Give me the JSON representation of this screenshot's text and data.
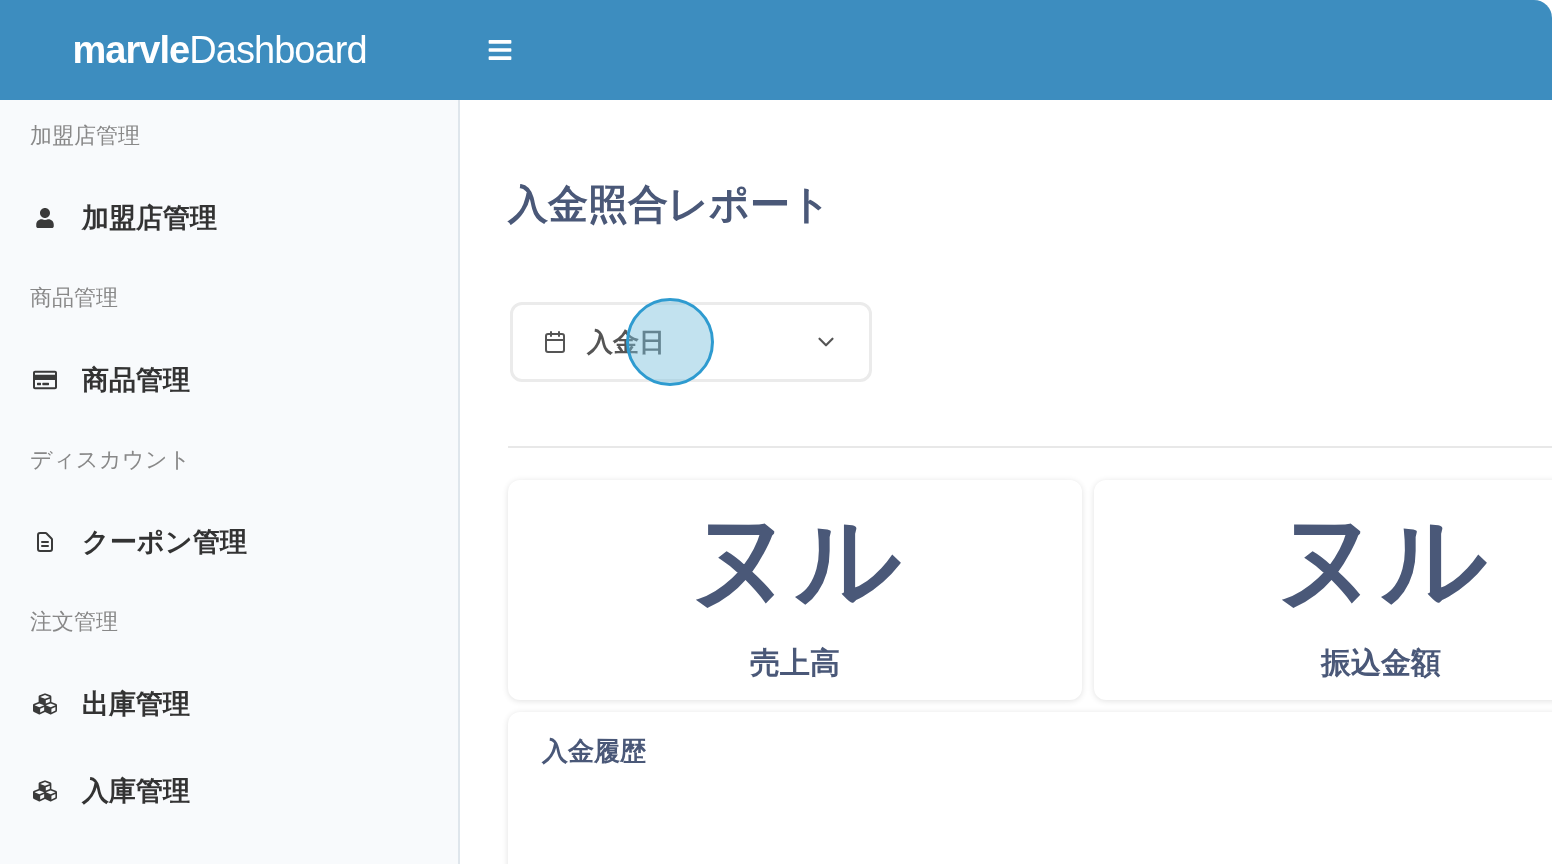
{
  "header": {
    "logo_bold": "marvle",
    "logo_light": "Dashboard"
  },
  "sidebar": {
    "sections": [
      {
        "label": "加盟店管理",
        "items": [
          {
            "label": "加盟店管理",
            "kind": "user"
          }
        ]
      },
      {
        "label": "商品管理",
        "items": [
          {
            "label": "商品管理",
            "kind": "card"
          }
        ]
      },
      {
        "label": "ディスカウント",
        "items": [
          {
            "label": "クーポン管理",
            "kind": "file"
          }
        ]
      },
      {
        "label": "注文管理",
        "items": [
          {
            "label": "出庫管理",
            "kind": "cubes"
          },
          {
            "label": "入庫管理",
            "kind": "cubes"
          }
        ]
      }
    ]
  },
  "main": {
    "title": "入金照合レポート",
    "date_select": {
      "value": "入金日"
    },
    "stats": [
      {
        "value": "ヌル",
        "label": "売上高"
      },
      {
        "value": "ヌル",
        "label": "振込金額"
      }
    ],
    "history": {
      "title": "入金履歴"
    },
    "click_indicator": true
  }
}
